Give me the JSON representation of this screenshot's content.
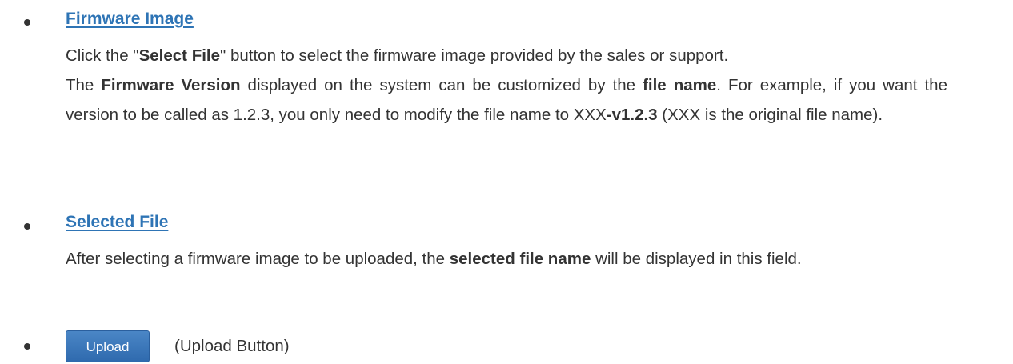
{
  "firmware_image": {
    "heading": "Firmware Image",
    "line1_pre": "Click the \"",
    "line1_bold": "Select File",
    "line1_post": "\" button to select the firmware image provided by the sales or support.",
    "p2_a": "The ",
    "p2_b_bold": "Firmware Version",
    "p2_c": " displayed on the system can be customized by the ",
    "p2_d_bold": "file name",
    "p2_e": ". For example, if you want the version to be called as 1.2.3, you only need to modify the file name to XXX",
    "p2_f_bold": "-v1.2.3",
    "p2_g": " (XXX is the original file name)."
  },
  "selected_file": {
    "heading": "Selected File",
    "p_a": "After selecting a firmware image to be uploaded, the ",
    "p_b_bold": "selected file name",
    "p_c": " will be displayed in this field."
  },
  "upload": {
    "button_label": "Upload",
    "caption": "(Upload Button)"
  }
}
